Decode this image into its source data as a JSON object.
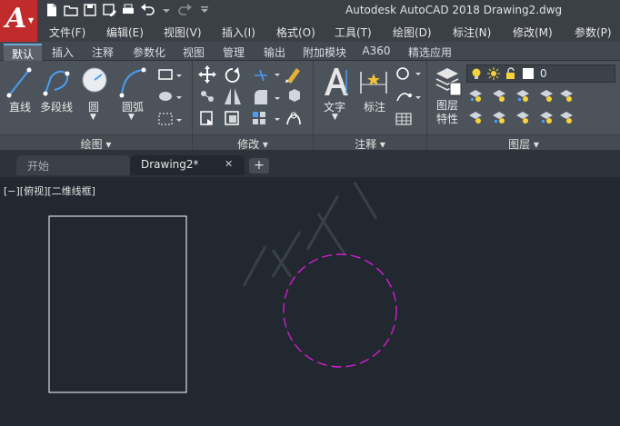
{
  "titlebar": {
    "app_letter": "A",
    "title": "Autodesk AutoCAD 2018    Drawing2.dwg"
  },
  "menubar": {
    "items": [
      "文件(F)",
      "编辑(E)",
      "视图(V)",
      "插入(I)",
      "格式(O)",
      "工具(T)",
      "绘图(D)",
      "标注(N)",
      "修改(M)",
      "参数(P)"
    ]
  },
  "ribbon_tabs": {
    "items": [
      "默认",
      "插入",
      "注释",
      "参数化",
      "视图",
      "管理",
      "输出",
      "附加模块",
      "A360",
      "精选应用"
    ],
    "active": "默认"
  },
  "panels": {
    "draw": {
      "title": "绘图 ▾",
      "line": "直线",
      "polyline": "多段线",
      "circle": "圆",
      "arc": "圆弧"
    },
    "modify": {
      "title": "修改 ▾"
    },
    "annotation": {
      "title": "注释 ▾",
      "text": "文字",
      "dimension": "标注"
    },
    "layers": {
      "title": "图层 ▾",
      "layer_props_line1": "图层",
      "layer_props_line2": "特性",
      "current_layer": "0"
    }
  },
  "doc_tabs": {
    "start": "开始",
    "drawing": "Drawing2*",
    "close": "✕",
    "new": "+"
  },
  "viewport": {
    "label": "[−][俯视][二维线框]"
  },
  "colors": {
    "accent": "#6fa9dc",
    "logo": "#c22b2b",
    "circle_layer": "#d21cd2",
    "rectangle": "#ffffff",
    "canvas": "#212830"
  },
  "icons": [
    "new-file-icon",
    "open-folder-icon",
    "save-icon",
    "save-as-icon",
    "print-icon",
    "undo-icon",
    "redo-icon",
    "lightbulb-icon",
    "sun-icon",
    "lock-icon"
  ]
}
